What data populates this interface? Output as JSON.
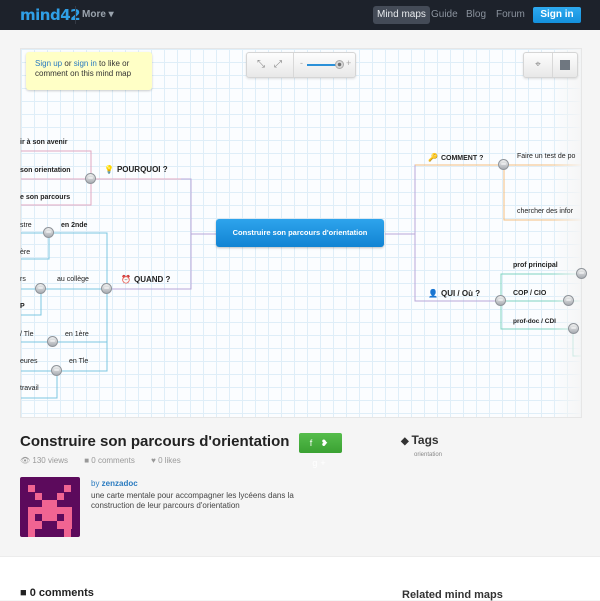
{
  "header": {
    "logo": "mind42",
    "more_label": "More ▾",
    "nav": [
      "Mind maps",
      "Guide",
      "Blog",
      "Forum"
    ],
    "active_nav": "Mind maps",
    "signin_label": "Sign in"
  },
  "map": {
    "signup_note": {
      "signup_link": "Sign up",
      "or": " or ",
      "signin_link": "sign in",
      "rest": " to like or comment on this mind map"
    },
    "toolbar": {
      "collapse_icon": "⤡",
      "expand_icon": "⤢",
      "zoom_minus": "-",
      "zoom_plus": "+",
      "zoom_level": 0.85,
      "center_icon": "⌖",
      "fullscreen_icon": "⤢"
    },
    "root": "Construire son parcours d'orientation",
    "branches": {
      "pourquoi": {
        "label": "POURQUOI ?",
        "icon": "💡",
        "color": "#e0a8c0",
        "children": [
          "ir à son avenir",
          "son orientation",
          "e son parcours"
        ]
      },
      "quand": {
        "label": "QUAND ?",
        "icon": "⏰",
        "color": "#7cc6e0",
        "children": [
          {
            "label": "en 2nde",
            "children": [
              "stre",
              "ère"
            ]
          },
          {
            "label": "au collège",
            "children": [
              "rs",
              "P"
            ]
          },
          {
            "label": "en 1ère",
            "children": [
              "/ Tle"
            ]
          },
          {
            "label": "en Tle",
            "children": [
              "eures",
              "travail"
            ]
          }
        ]
      },
      "comment": {
        "label": "COMMENT ?",
        "icon": "🔑",
        "color": "#f5c080",
        "children": [
          "Faire un test de po",
          "chercher des infor"
        ]
      },
      "qui": {
        "label": "QUI / Où ?",
        "icon": "👤",
        "color": "#7fd4c0",
        "children": [
          "prof principal",
          "COP / CIO",
          "prof-doc / CDI"
        ]
      }
    }
  },
  "details": {
    "title": "Construire son parcours d'orientation",
    "share_label": "f ❥ g+",
    "views": "130 views",
    "comments": "0 comments",
    "likes": "0 likes",
    "author_prefix": "by ",
    "author": "zenzadoc",
    "description": "une carte mentale pour accompagner les lycéens dans la construction de leur parcours d'orientation"
  },
  "tags": {
    "title": "Tags",
    "items": [
      "orientation"
    ]
  },
  "footer": {
    "comments_heading": "0 comments",
    "related_heading": "Related mind maps"
  },
  "colors": {
    "topbar": "#1d222b",
    "accent": "#1a91dd",
    "share_green": "#45ad3c",
    "avatar_bg": "#5c0a5c",
    "avatar_fg": "#f06492"
  }
}
